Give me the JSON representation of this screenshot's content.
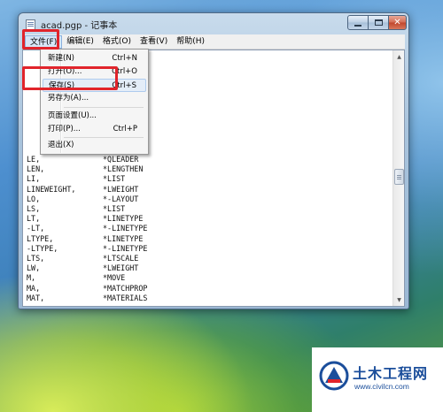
{
  "window": {
    "title": "acad.pgp - 记事本",
    "controls": {
      "minimize": "minimize",
      "maximize": "maximize",
      "close": "✕"
    }
  },
  "menubar": {
    "items": [
      "文件(F)",
      "编辑(E)",
      "格式(O)",
      "查看(V)",
      "帮助(H)"
    ],
    "active_index": 0
  },
  "file_menu": {
    "items": [
      {
        "label": "新建(N)",
        "shortcut": "Ctrl+N"
      },
      {
        "label": "打开(O)...",
        "shortcut": "Ctrl+O"
      },
      {
        "label": "保存(S)",
        "shortcut": "Ctrl+S"
      },
      {
        "label": "另存为(A)...",
        "shortcut": ""
      },
      {
        "label": "页面设置(U)...",
        "shortcut": ""
      },
      {
        "label": "打印(P)...",
        "shortcut": "Ctrl+P"
      },
      {
        "label": "退出(X)",
        "shortcut": ""
      }
    ],
    "highlighted_index": 2
  },
  "editor": {
    "lines": [
      {
        "cmd": "LE,",
        "alias": "*QLEADER"
      },
      {
        "cmd": "LEN,",
        "alias": "*LENGTHEN"
      },
      {
        "cmd": "LI,",
        "alias": "*LIST"
      },
      {
        "cmd": "LINEWEIGHT,",
        "alias": "*LWEIGHT"
      },
      {
        "cmd": "LO,",
        "alias": "*-LAYOUT"
      },
      {
        "cmd": "LS,",
        "alias": "*LIST"
      },
      {
        "cmd": "LT,",
        "alias": "*LINETYPE"
      },
      {
        "cmd": "-LT,",
        "alias": "*-LINETYPE"
      },
      {
        "cmd": "LTYPE,",
        "alias": "*LINETYPE"
      },
      {
        "cmd": "-LTYPE,",
        "alias": "*-LINETYPE"
      },
      {
        "cmd": "LTS,",
        "alias": "*LTSCALE"
      },
      {
        "cmd": "LW,",
        "alias": "*LWEIGHT"
      },
      {
        "cmd": "M,",
        "alias": "*MOVE"
      },
      {
        "cmd": "MA,",
        "alias": "*MATCHPROP"
      },
      {
        "cmd": "MAT,",
        "alias": "*MATERIALS"
      }
    ]
  },
  "watermark": {
    "title": "土木工程网",
    "url": "www.civilcn.com",
    "colors": {
      "brand": "#1b4e9b",
      "accent": "#e1242b"
    }
  },
  "highlight_color": "#e1242b"
}
